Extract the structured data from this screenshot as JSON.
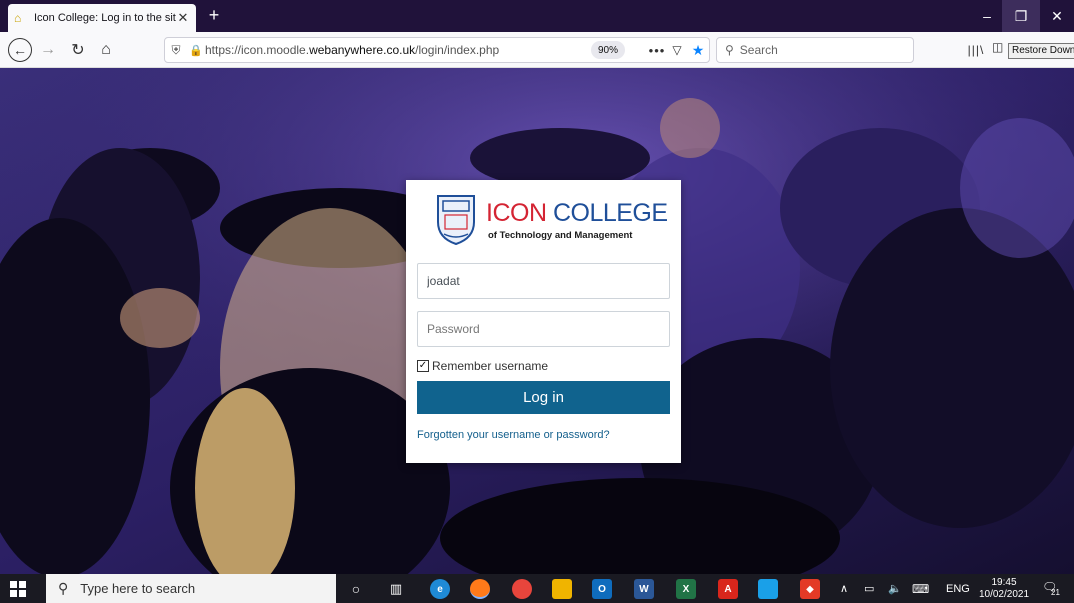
{
  "browser": {
    "tab_title": "Icon College: Log in to the site",
    "url_prefix": "https://icon.moodle.",
    "url_host": "webanywhere.co.uk",
    "url_path": "/login/index.php",
    "zoom": "90%",
    "search_placeholder": "Search",
    "tooltip": "Restore Down"
  },
  "logo": {
    "name_part1": "ICON",
    "name_part2": "COLLEGE",
    "tagline": "of Technology and Management"
  },
  "login": {
    "username_value": "joadat",
    "password_placeholder": "Password",
    "remember_label": "Remember username",
    "remember_checked": true,
    "login_button": "Log in",
    "forgot_link": "Forgotten your username or password?"
  },
  "taskbar": {
    "search_placeholder": "Type here to search",
    "language": "ENG",
    "time": "19:45",
    "date": "10/02/2021",
    "notification_count": "21"
  },
  "colors": {
    "login_button": "#10638e",
    "logo_red": "#d42433",
    "logo_blue": "#1f4f99"
  }
}
